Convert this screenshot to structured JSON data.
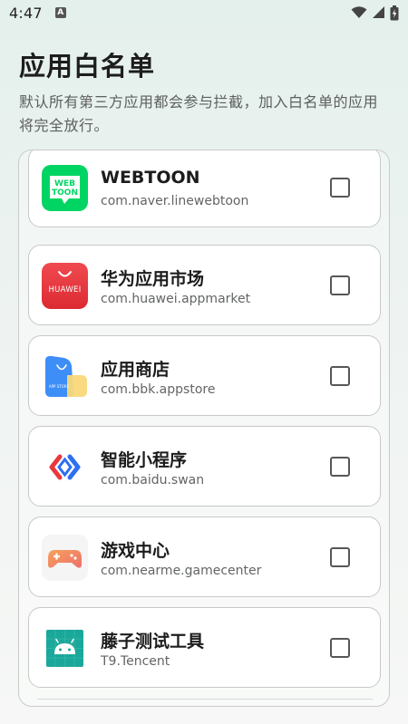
{
  "status_bar": {
    "time": "4:47",
    "notification_badge": "A",
    "icons": [
      "wifi-icon",
      "cellular-signal-icon",
      "battery-charging-icon"
    ]
  },
  "page": {
    "title": "应用白名单",
    "description": "默认所有第三方应用都会参与拦截，加入白名单的应用将完全放行。"
  },
  "apps": [
    {
      "name": "WEBTOON",
      "package": "com.naver.linewebtoon",
      "icon": "webtoon-app-icon",
      "icon_text": "WEB TOON",
      "checked": false
    },
    {
      "name": "华为应用市场",
      "package": "com.huawei.appmarket",
      "icon": "huawei-appgallery-icon",
      "icon_text": "HUAWEI",
      "checked": false
    },
    {
      "name": "应用商店",
      "package": "com.bbk.appstore",
      "icon": "vivo-appstore-icon",
      "icon_text": "APP STORE",
      "checked": false
    },
    {
      "name": "智能小程序",
      "package": "com.baidu.swan",
      "icon": "baidu-smart-mini-program-icon",
      "checked": false
    },
    {
      "name": "游戏中心",
      "package": "com.nearme.gamecenter",
      "icon": "game-center-icon",
      "checked": false
    },
    {
      "name": "藤子测试工具",
      "package": "T9.Tencent",
      "icon": "android-robot-icon",
      "checked": false
    }
  ],
  "colors": {
    "webtoon_green": "#00d564",
    "huawei_red": "#e8333c",
    "appstore_blue": "#3e8ef7",
    "appstore_yellow": "#f9d87a",
    "swan_red": "#e8383d",
    "swan_blue": "#2e6ff2",
    "game_orange": "#f08f5a",
    "android_teal": "#1ba89a"
  }
}
